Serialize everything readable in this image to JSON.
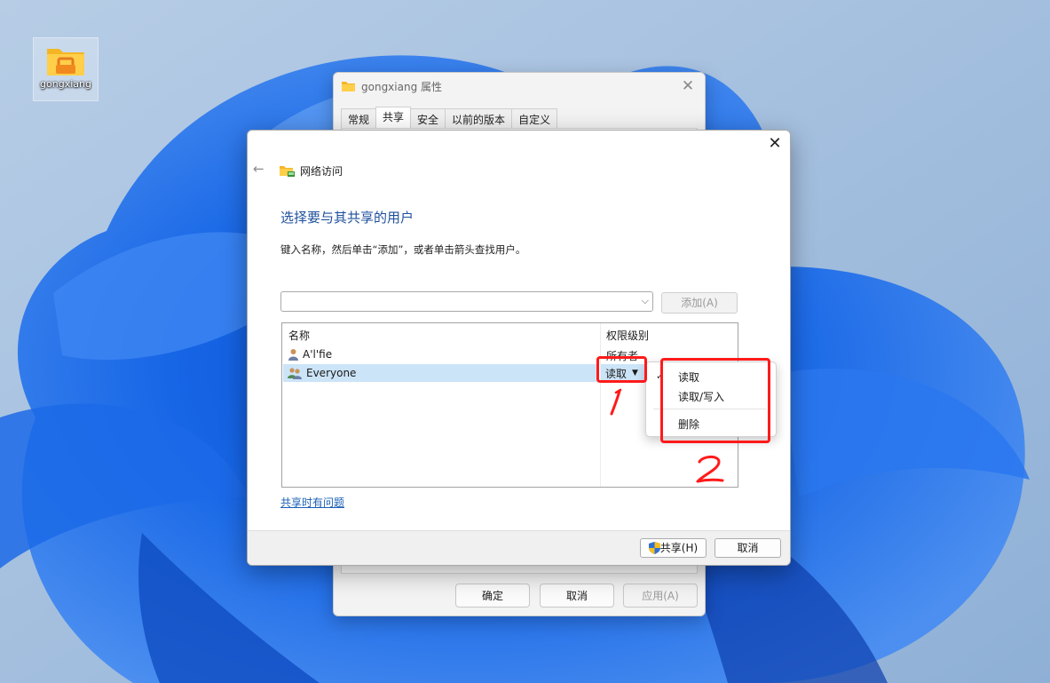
{
  "desktop": {
    "folder_label": "gongxiang"
  },
  "properties_window": {
    "title": "gongxiang 属性",
    "tabs": [
      {
        "label": "常规",
        "active": false
      },
      {
        "label": "共享",
        "active": true
      },
      {
        "label": "安全",
        "active": false
      },
      {
        "label": "以前的版本",
        "active": false
      },
      {
        "label": "自定义",
        "active": false
      }
    ],
    "buttons": {
      "ok": "确定",
      "cancel": "取消",
      "apply": "应用(A)"
    }
  },
  "network_dialog": {
    "breadcrumb": "网络访问",
    "heading": "选择要与其共享的用户",
    "hint": "键入名称，然后单击“添加”，或者单击箭头查找用户。",
    "search": {
      "value": "",
      "placeholder": ""
    },
    "add_button": "添加(A)",
    "columns": {
      "name": "名称",
      "permission": "权限级别"
    },
    "users": [
      {
        "name": "A'l'fie",
        "permission": "所有者",
        "icon": "user-icon",
        "selected": false
      },
      {
        "name": "Everyone",
        "permission": "读取",
        "icon": "group-icon",
        "selected": true
      }
    ],
    "help_link": "共享时有问题",
    "buttons": {
      "share": "共享(H)",
      "cancel": "取消"
    }
  },
  "permission_menu": {
    "items": [
      "读取",
      "读取/写入",
      "删除"
    ],
    "checked": "读取"
  },
  "annotations": {
    "label_1": "1",
    "label_2": "2",
    "color": "#ff1a1a"
  },
  "colors": {
    "accent": "#1e4f9c",
    "selection": "#cce4f7",
    "link": "#1a5fb4"
  }
}
